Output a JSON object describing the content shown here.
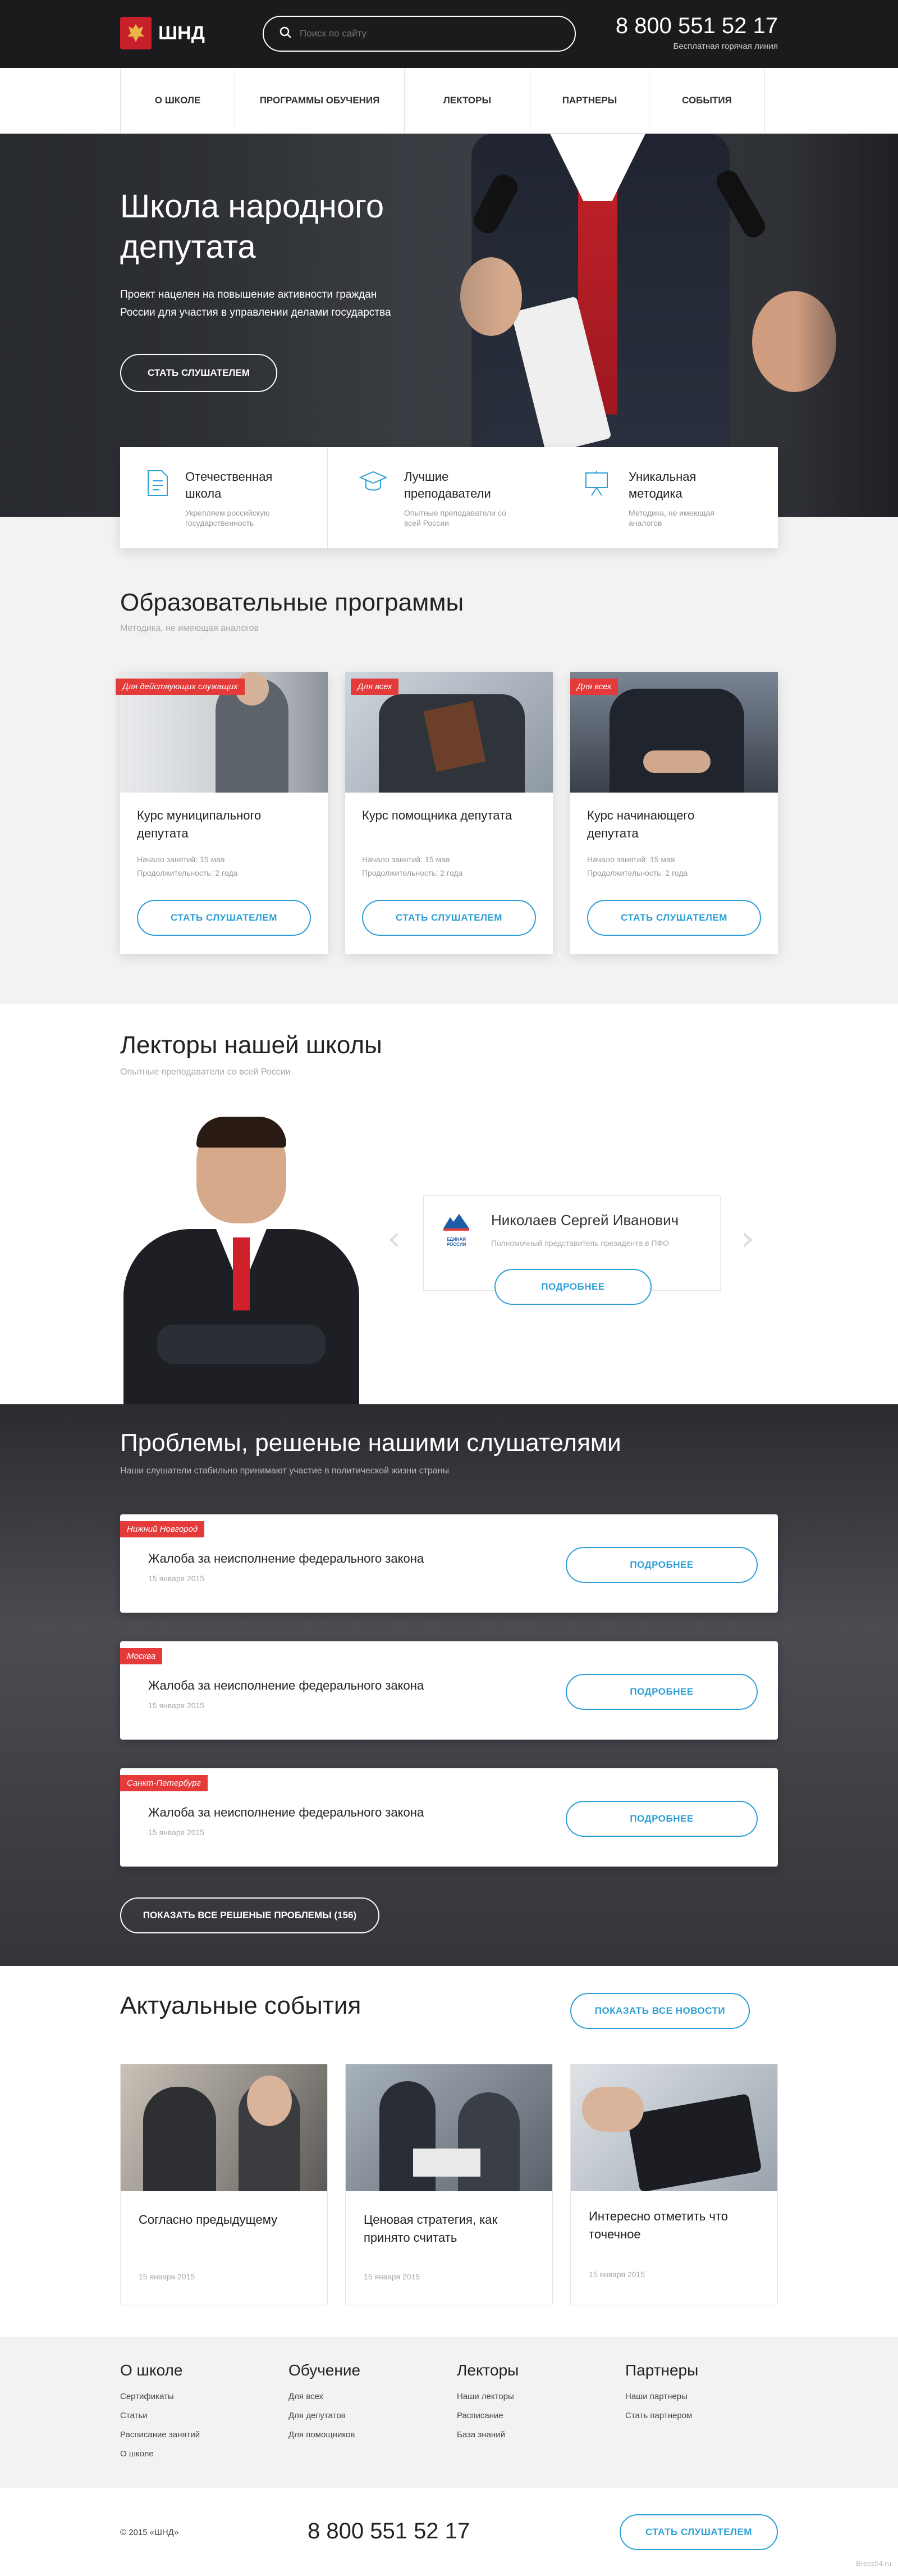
{
  "header": {
    "logo_text": "ШНД",
    "search_placeholder": "Поиск по сайту",
    "phone": "8 800 551 52 17",
    "phone_caption": "Бесплатная горячая линия"
  },
  "nav": [
    "О ШКОЛЕ",
    "ПРОГРАММЫ ОБУЧЕНИЯ",
    "ЛЕКТОРЫ",
    "ПАРТНЕРЫ",
    "СОБЫТИЯ"
  ],
  "hero": {
    "title_line1": "Школа народного",
    "title_line2": "депутата",
    "subtitle_line1": "Проект нацелен на повышение активности граждан",
    "subtitle_line2": "России для участия в управлении делами государства",
    "cta": "СТАТЬ СЛУШАТЕЛЕМ"
  },
  "features": [
    {
      "title": "Отечественная школа",
      "desc": "Укрепляем российскую государственность",
      "icon": "document-icon"
    },
    {
      "title": "Лучшие преподаватели",
      "desc": "Опытные преподаватели со всей России",
      "icon": "graduation-cap-icon"
    },
    {
      "title": "Уникальная методика",
      "desc": "Методика, не имеющая аналогов",
      "icon": "presentation-board-icon"
    }
  ],
  "programs": {
    "title": "Образовательные программы",
    "subtitle": "Методика, не имеющая аналогов",
    "items": [
      {
        "tag": "Для действующих служащих",
        "title": "Курс муниципального депутата",
        "start": "Начало занятий: 15 мая",
        "duration": "Продолжительность: 2 года",
        "cta": "СТАТЬ СЛУШАТЕЛЕМ"
      },
      {
        "tag": "Для всех",
        "title": "Курс помощника депутата",
        "start": "Начало занятий: 15 мая",
        "duration": "Продолжительность: 2 года",
        "cta": "СТАТЬ СЛУШАТЕЛЕМ"
      },
      {
        "tag": "Для всех",
        "title": "Курс начинающего депутата",
        "start": "Начало занятий: 15 мая",
        "duration": "Продолжительность: 2 года",
        "cta": "СТАТЬ СЛУШАТЕЛЕМ"
      }
    ]
  },
  "lecturers": {
    "title": "Лекторы нашей школы",
    "subtitle": "Опытные преподаватели со всей России",
    "name": "Николаев Сергей Иванович",
    "role": "Полномочный представитель президента в ПФО",
    "party_logo_text": "ЕДИНАЯ РОССИЯ",
    "cta": "ПОДРОБНЕЕ"
  },
  "problems": {
    "title": "Проблемы, решеные нашими слушателями",
    "subtitle": "Наши слушатели стабильно принимают участие в политической жизни страны",
    "items": [
      {
        "tag": "Нижний Новгород",
        "title": "Жалоба за неисполнение федерального закона",
        "date": "15 января 2015",
        "cta": "ПОДРОБНЕЕ"
      },
      {
        "tag": "Москва",
        "title": "Жалоба за неисполнение федерального закона",
        "date": "15 января 2015",
        "cta": "ПОДРОБНЕЕ"
      },
      {
        "tag": "Санкт-Петербург",
        "title": "Жалоба за неисполнение федерального закона",
        "date": "15 января 2015",
        "cta": "ПОДРОБНЕЕ"
      }
    ],
    "show_all": "ПОКАЗАТЬ ВСЕ РЕШЕНЫЕ ПРОБЛЕМЫ (156)"
  },
  "events": {
    "title": "Актуальные события",
    "show_all": "ПОКАЗАТЬ ВСЕ НОВОСТИ",
    "items": [
      {
        "title_line1": "Согласно предыдущему",
        "title_line2": "",
        "date": "15 января 2015"
      },
      {
        "title_line1": "Ценовая стратегия, как",
        "title_line2": "принято считать",
        "date": "15 января 2015"
      },
      {
        "title_line1": "Интересно отметить что",
        "title_line2": "точечное",
        "date": "15 января 2015"
      }
    ]
  },
  "footer": {
    "columns": [
      {
        "title": "О школе",
        "links": [
          "Сертификаты",
          "Статьи",
          "Расписание занятий",
          "О школе"
        ]
      },
      {
        "title": "Обучение",
        "links": [
          "Для всех",
          "Для депутатов",
          "Для помощников"
        ]
      },
      {
        "title": "Лекторы",
        "links": [
          "Наши лекторы",
          "Расписание",
          "База знаний"
        ]
      },
      {
        "title": "Партнеры",
        "links": [
          "Наши партнеры",
          "Стать партнером"
        ]
      }
    ],
    "copyright": "© 2015 «ШНД»",
    "phone": "8 800 551 52 17",
    "cta": "СТАТЬ СЛУШАТЕЛЕМ",
    "credit": "Brecs54.ru"
  },
  "colors": {
    "accent": "#2d9fd6",
    "tag_red": "#e53a3a",
    "dark": "#1b1b1d"
  }
}
